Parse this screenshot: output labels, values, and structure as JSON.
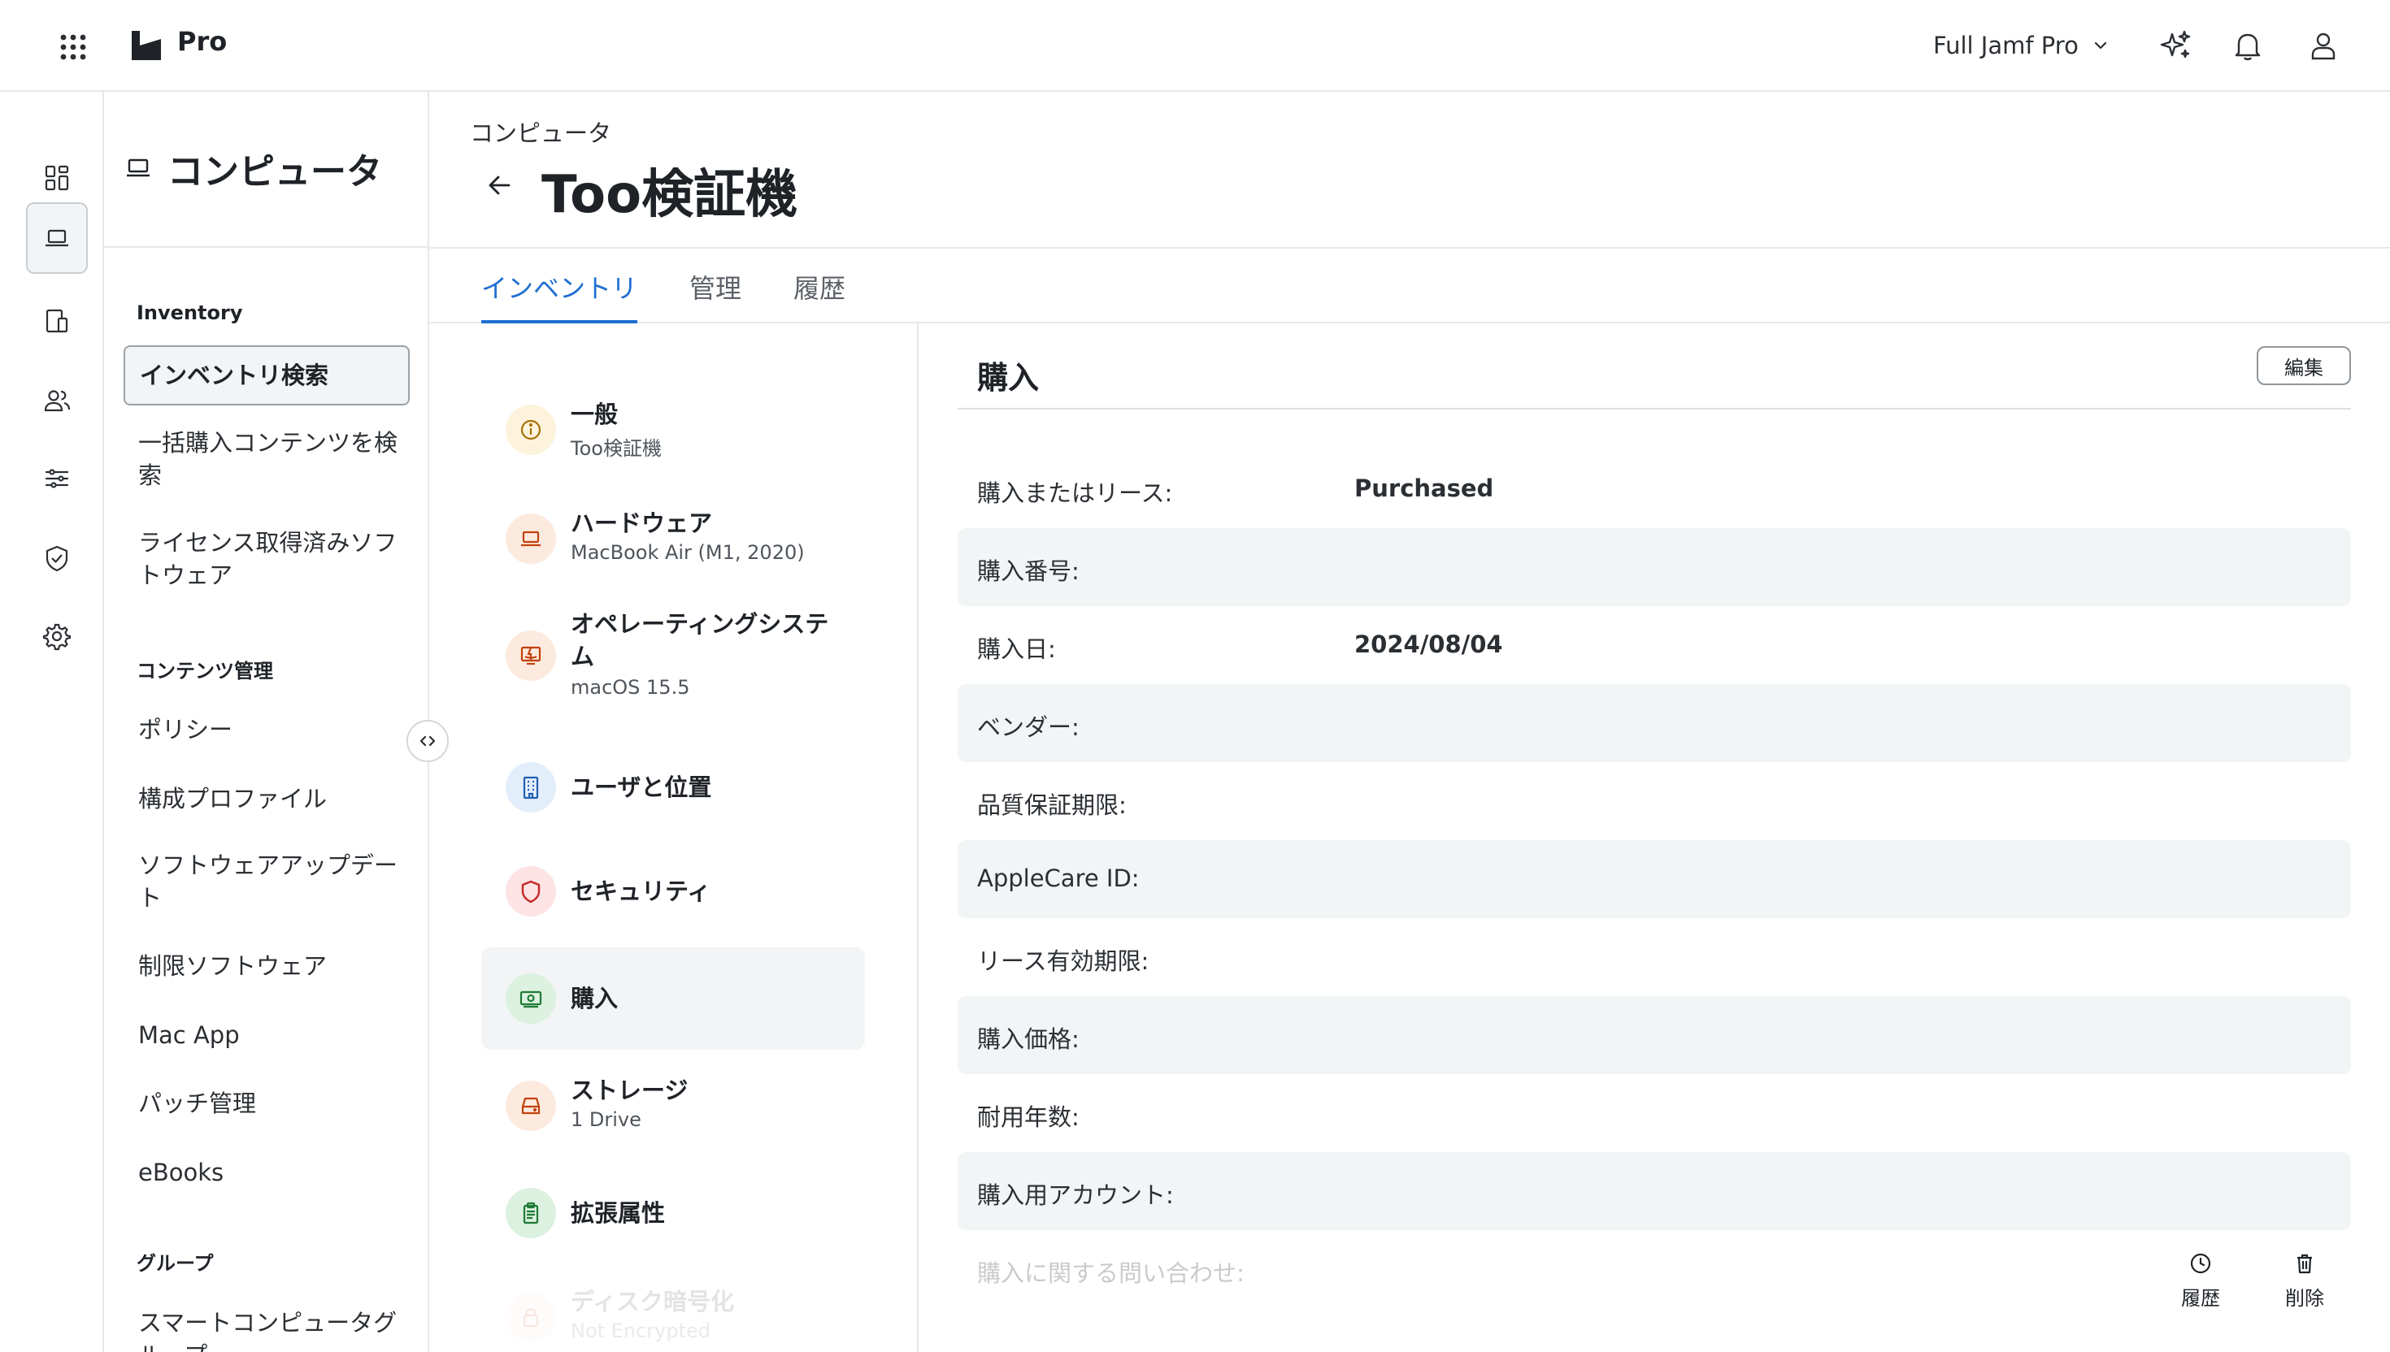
{
  "topbar": {
    "brand": "Pro",
    "environment": "Full Jamf Pro",
    "icons": [
      "apps-grid-icon",
      "jamf-logo-icon",
      "sparkle-icon",
      "bell-icon",
      "user-icon",
      "chevron-down-icon"
    ]
  },
  "rail": {
    "icons": [
      "dashboard-icon",
      "computer-icon",
      "mobile-devices-icon",
      "users-icon",
      "settings-sliders-icon",
      "shield-check-icon",
      "gear-icon"
    ]
  },
  "sidebar": {
    "title": "コンピュータ",
    "groups": {
      "inventory": "Inventory",
      "content": "コンテンツ管理",
      "groups": "グループ"
    },
    "items": {
      "inventory_search": "インベントリ検索",
      "bulk_search": "一括購入コンテンツを検索",
      "licensed_software": "ライセンス取得済みソフトウェア",
      "policies": "ポリシー",
      "config_profiles": "構成プロファイル",
      "software_updates": "ソフトウェアアップデート",
      "restricted_software": "制限ソフトウェア",
      "mac_app": "Mac App",
      "patch_management": "パッチ管理",
      "ebooks": "eBooks",
      "smart_groups": "スマートコンピュータグループ"
    }
  },
  "header": {
    "breadcrumb": "コンピュータ",
    "title": "Too検証機",
    "tabs": [
      "インベントリ",
      "管理",
      "履歴"
    ]
  },
  "categories": [
    {
      "name": "一般",
      "sub": "Too検証機",
      "icon": "info-icon"
    },
    {
      "name": "ハードウェア",
      "sub": "MacBook Air (M1, 2020)",
      "icon": "laptop-icon"
    },
    {
      "name": "オペレーティングシステム",
      "sub": "macOS 15.5",
      "icon": "finder-icon"
    },
    {
      "name": "ユーザと位置",
      "sub": "",
      "icon": "building-icon"
    },
    {
      "name": "セキュリティ",
      "sub": "",
      "icon": "shield-icon"
    },
    {
      "name": "購入",
      "sub": "",
      "icon": "money-icon"
    },
    {
      "name": "ストレージ",
      "sub": "1 Drive",
      "icon": "drive-icon"
    },
    {
      "name": "拡張属性",
      "sub": "",
      "icon": "clipboard-icon"
    },
    {
      "name": "ディスク暗号化",
      "sub": "Not Encrypted",
      "icon": "lock-icon"
    }
  ],
  "purchase": {
    "title": "購入",
    "edit_label": "編集",
    "rows": [
      {
        "label": "購入またはリース:",
        "value": "Purchased"
      },
      {
        "label": "購入番号:",
        "value": ""
      },
      {
        "label": "購入日:",
        "value": "2024/08/04"
      },
      {
        "label": "ベンダー:",
        "value": ""
      },
      {
        "label": "品質保証期限:",
        "value": ""
      },
      {
        "label": "AppleCare ID:",
        "value": ""
      },
      {
        "label": "リース有効期限:",
        "value": ""
      },
      {
        "label": "購入価格:",
        "value": ""
      },
      {
        "label": "耐用年数:",
        "value": ""
      },
      {
        "label": "購入用アカウント:",
        "value": ""
      },
      {
        "label": "購入に関する問い合わせ:",
        "value": ""
      }
    ],
    "actions": {
      "history": "履歴",
      "delete": "削除"
    }
  }
}
